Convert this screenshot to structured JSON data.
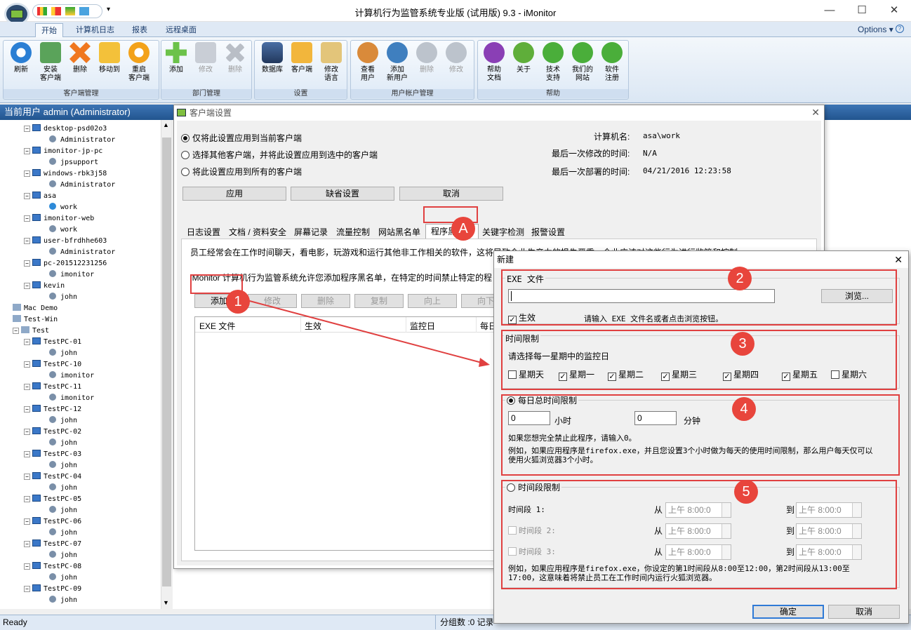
{
  "window": {
    "title": "计算机行为监管系统专业版 (试用版) 9.3 - iMonitor",
    "options": "Options"
  },
  "ribbon_tabs": [
    "开始",
    "计算机日志",
    "报表",
    "远程桌面"
  ],
  "ribbon_groups": {
    "client": {
      "label": "客户端管理",
      "buttons": [
        "刷新",
        "安装\n客户端",
        "删除",
        "移动到",
        "重启\n客户端"
      ]
    },
    "dept": {
      "label": "部门管理",
      "buttons": [
        "添加",
        "修改",
        "删除"
      ]
    },
    "settings": {
      "label": "设置",
      "buttons": [
        "数据库",
        "客户端",
        "修改\n语言"
      ]
    },
    "users": {
      "label": "用户帐户管理",
      "buttons": [
        "查看\n用户",
        "添加\n新用户",
        "删除",
        "修改"
      ]
    },
    "help": {
      "label": "帮助",
      "buttons": [
        "帮助\n文档",
        "关于",
        "技术\n支持",
        "我们的\n网站",
        "软件\n注册"
      ]
    }
  },
  "left": {
    "header": "当前用户 admin (Administrator)"
  },
  "tree": [
    {
      "t": "pc",
      "text": "desktop-psd02o3"
    },
    {
      "t": "user",
      "text": "Administrator"
    },
    {
      "t": "pc",
      "text": "imonitor-jp-pc"
    },
    {
      "t": "user",
      "text": "jpsupport"
    },
    {
      "t": "pc",
      "text": "windows-rbk3j58"
    },
    {
      "t": "user",
      "text": "Administrator"
    },
    {
      "t": "pc",
      "text": "asa"
    },
    {
      "t": "user",
      "text": "work"
    },
    {
      "t": "pc",
      "text": "imonitor-web"
    },
    {
      "t": "user",
      "text": "work"
    },
    {
      "t": "pc",
      "text": "user-bfrdhhe603"
    },
    {
      "t": "user",
      "text": "Administrator"
    },
    {
      "t": "pc",
      "text": "pc-201512231256"
    },
    {
      "t": "user",
      "text": "imonitor"
    },
    {
      "t": "pc",
      "text": "kevin"
    },
    {
      "t": "user",
      "text": "john"
    },
    {
      "t": "grp",
      "text": "Mac Demo"
    },
    {
      "t": "grp",
      "text": "Test-Win"
    },
    {
      "t": "grp",
      "text": "Test"
    },
    {
      "t": "pc",
      "text": "TestPC-01"
    },
    {
      "t": "user",
      "text": "john"
    },
    {
      "t": "pc",
      "text": "TestPC-10"
    },
    {
      "t": "user",
      "text": "imonitor"
    },
    {
      "t": "pc",
      "text": "TestPC-11"
    },
    {
      "t": "user",
      "text": "imonitor"
    },
    {
      "t": "pc",
      "text": "TestPC-12"
    },
    {
      "t": "user",
      "text": "john"
    },
    {
      "t": "pc",
      "text": "TestPC-02"
    },
    {
      "t": "user",
      "text": "john"
    },
    {
      "t": "pc",
      "text": "TestPC-03"
    },
    {
      "t": "user",
      "text": "john"
    },
    {
      "t": "pc",
      "text": "TestPC-04"
    },
    {
      "t": "user",
      "text": "john"
    },
    {
      "t": "pc",
      "text": "TestPC-05"
    },
    {
      "t": "user",
      "text": "john"
    },
    {
      "t": "pc",
      "text": "TestPC-06"
    },
    {
      "t": "user",
      "text": "john"
    },
    {
      "t": "pc",
      "text": "TestPC-07"
    },
    {
      "t": "user",
      "text": "john"
    },
    {
      "t": "pc",
      "text": "TestPC-08"
    },
    {
      "t": "user",
      "text": "john"
    },
    {
      "t": "pc",
      "text": "TestPC-09"
    },
    {
      "t": "user",
      "text": "john"
    }
  ],
  "status": {
    "ready": "Ready",
    "count": "分组数 :0  记录"
  },
  "client_dialog": {
    "title": "客户端设置",
    "radio1": "仅将此设置应用到当前客户端",
    "radio2": "选择其他客户端，并将此设置应用到选中的客户端",
    "radio3": "将此设置应用到所有的客户端",
    "computer_label": "计算机名:",
    "computer_value": "asa\\work",
    "modified_label": "最后一次修改的时间:",
    "modified_value": "N/A",
    "deployed_label": "最后一次部署的时间:",
    "deployed_value": "04/21/2016 12:23:58",
    "apply": "应用",
    "default": "缺省设置",
    "cancel": "取消",
    "tabs": [
      "日志设置",
      "文档 / 资料安全",
      "屏幕记录",
      "流量控制",
      "网站黑名单",
      "程序黑名单",
      "关键字检测",
      "报警设置"
    ],
    "desc1": "员工经常会在工作时间聊天，看电影，玩游戏和运行其他非工作相关的软件，这将导致企业生产力的损失严重。企业应该对这些行为进行监管和控制。",
    "desc2": "iMonitor 计算机行为监管系统允许您添加程序黑名单，在特定的时间禁止特定的程序",
    "toolbar": [
      "添加",
      "修改",
      "删除",
      "复制",
      "向上",
      "向下"
    ],
    "columns": [
      "EXE 文件",
      "生效",
      "监控日",
      "每日"
    ]
  },
  "new_dialog": {
    "title": "新建",
    "exe_legend": "EXE 文件",
    "exe_value": "",
    "browse": "浏览...",
    "enabled": "生效",
    "exe_hint": "请输入 EXE 文件名或者点击浏览按钮。",
    "time_legend": "时间限制",
    "time_hint": "请选择每一星期中的监控日",
    "days": [
      {
        "label": "星期天",
        "checked": false
      },
      {
        "label": "星期一",
        "checked": true
      },
      {
        "label": "星期二",
        "checked": true
      },
      {
        "label": "星期三",
        "checked": true
      },
      {
        "label": "星期四",
        "checked": true
      },
      {
        "label": "星期五",
        "checked": true
      },
      {
        "label": "星期六",
        "checked": false
      }
    ],
    "daily_legend": "每日总时间限制",
    "hours_value": "0",
    "hours_unit": "小时",
    "minutes_value": "0",
    "minutes_unit": "分钟",
    "daily_hint": "如果您想完全禁止此程序，请输入0。",
    "daily_example": "例如，如果应用程序是firefox.exe，并且您设置3个小时做为每天的使用时间限制，那么用户每天仅可以使用火狐浏览器3个小时。",
    "period_legend": "时间段限制",
    "periods": [
      "时间段 1:",
      "时间段 2:",
      "时间段 3:"
    ],
    "from": "从",
    "to": "到",
    "time_value": "上午  8:00:0",
    "period_example": "例如，如果应用程序是firefox.exe，你设定的第1时间段从8:00至12:00，第2时间段从13:00至17:00，这意味着将禁止员工在工作时间内运行火狐浏览器。",
    "ok": "确定",
    "cancel": "取消"
  },
  "callouts": [
    "1",
    "2",
    "3",
    "4",
    "5",
    "A"
  ],
  "colors": {
    "callout": "#e8453c",
    "ribbon_blue": "#2b5797"
  }
}
